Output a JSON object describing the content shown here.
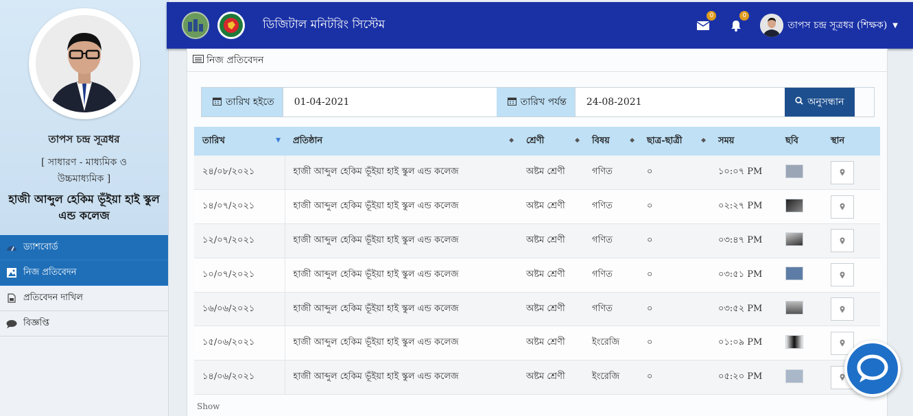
{
  "colors": {
    "topbar": "#1a31a6",
    "active_nav": "#1f6fb8",
    "header_bg": "#bfe0f5",
    "search_btn": "#1d4f8e",
    "badge": "#e09c1f",
    "chat": "#1e6fc7"
  },
  "header": {
    "title": "ডিজিটাল মনিটরিং সিস্টেম",
    "messages_badge": "0",
    "notifications_badge": "0",
    "user_name": "তাপস চন্দ্র সূত্রধর (শিক্ষক)"
  },
  "sidebar": {
    "name": "তাপস চন্দ্র সূত্রধর",
    "role": "[ সাধারণ - মাধ্যমিক ও উচ্চমাধ্যমিক ]",
    "school": "হাজী আব্দুল হেকিম ভূঁইয়া হাই স্কুল এন্ড কলেজ",
    "items": [
      {
        "label": "ড্যাশবোর্ড",
        "icon": "dashboard-icon"
      },
      {
        "label": "নিজ প্রতিবেদন",
        "icon": "image-icon"
      },
      {
        "label": "প্রতিবেদন দাখিল",
        "icon": "file-icon"
      },
      {
        "label": "বিজ্ঞপ্তি",
        "icon": "comment-icon"
      }
    ]
  },
  "panel": {
    "title": "নিজ প্রতিবেদন"
  },
  "filter": {
    "from_label": "তারিখ হইতে",
    "from_value": "01-04-2021",
    "to_label": "তারিখ পর্যন্ত",
    "to_value": "24-08-2021",
    "search_label": "অনুসন্ধান"
  },
  "table": {
    "columns": [
      "তারিখ",
      "প্রতিষ্ঠান",
      "শ্রেণী",
      "বিষয়",
      "ছাত্র-ছাত্রী",
      "সময়",
      "ছবি",
      "স্থান"
    ],
    "rows": [
      {
        "date": "২৪/০৮/২০২১",
        "school": "হাজী আব্দুল হেকিম ভূঁইয়া হাই স্কুল এন্ড কলেজ",
        "class": "অষ্টম শ্রেণী",
        "subject": "গণিত",
        "students": "০",
        "time": "১০:০৭ PM"
      },
      {
        "date": "১৪/০৭/২০২১",
        "school": "হাজী আব্দুল হেকিম ভূঁইয়া হাই স্কুল এন্ড কলেজ",
        "class": "অষ্টম শ্রেণী",
        "subject": "গণিত",
        "students": "০",
        "time": "০২:২৭ PM"
      },
      {
        "date": "১২/০৭/২০২১",
        "school": "হাজী আব্দুল হেকিম ভূঁইয়া হাই স্কুল এন্ড কলেজ",
        "class": "অষ্টম শ্রেণী",
        "subject": "গণিত",
        "students": "০",
        "time": "০৩:৪৭ PM"
      },
      {
        "date": "১০/০৭/২০২১",
        "school": "হাজী আব্দুল হেকিম ভূঁইয়া হাই স্কুল এন্ড কলেজ",
        "class": "অষ্টম শ্রেণী",
        "subject": "গণিত",
        "students": "০",
        "time": "০৩:৫১ PM"
      },
      {
        "date": "১৬/০৬/২০২১",
        "school": "হাজী আব্দুল হেকিম ভূঁইয়া হাই স্কুল এন্ড কলেজ",
        "class": "অষ্টম শ্রেণী",
        "subject": "গণিত",
        "students": "০",
        "time": "০৩:৫২ PM"
      },
      {
        "date": "১৫/০৬/২০২১",
        "school": "হাজী আব্দুল হেকিম ভূঁইয়া হাই স্কুল এন্ড কলেজ",
        "class": "অষ্টম শ্রেণী",
        "subject": "ইংরেজি",
        "students": "০",
        "time": "০১:০৯ PM"
      },
      {
        "date": "১৪/০৬/২০২১",
        "school": "হাজী আব্দুল হেকিম ভূঁইয়া হাই স্কুল এন্ড কলেজ",
        "class": "অষ্টম শ্রেণী",
        "subject": "ইংরেজি",
        "students": "০",
        "time": "০৫:২০ PM"
      }
    ]
  },
  "footer": {
    "show_label": "Show"
  }
}
